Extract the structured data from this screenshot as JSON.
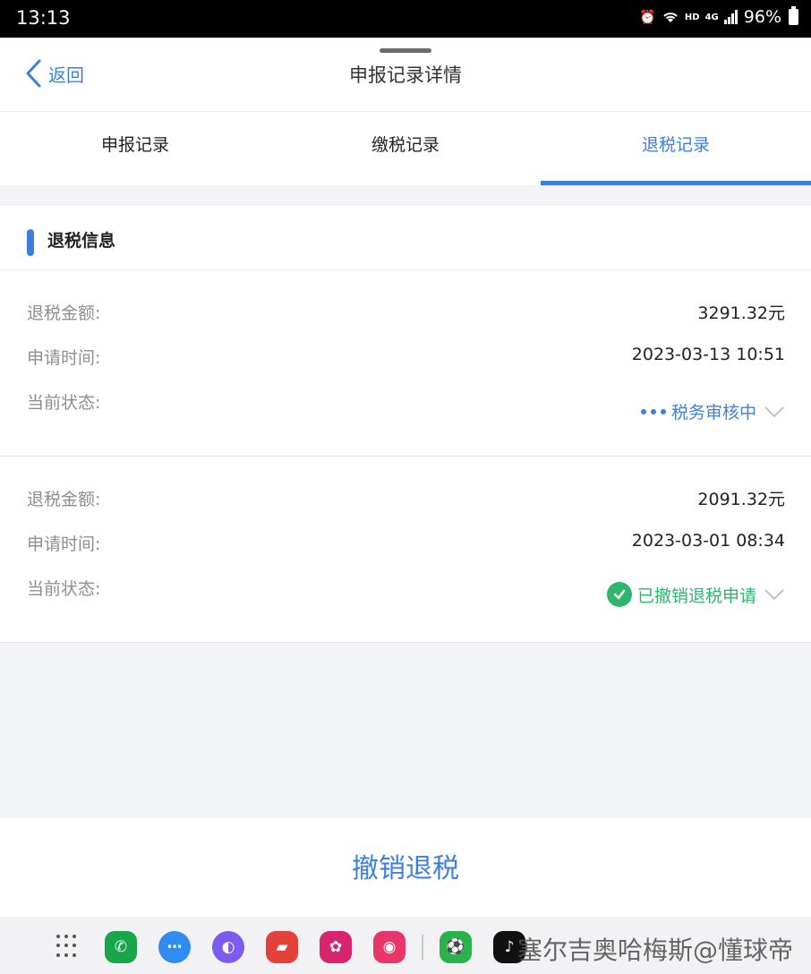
{
  "status_bar": {
    "time": "13:13",
    "hd": "HD",
    "network": "4G",
    "battery": "96%"
  },
  "header": {
    "back_label": "返回",
    "title": "申报记录详情"
  },
  "tabs": [
    {
      "label": "申报记录",
      "active": false
    },
    {
      "label": "缴税记录",
      "active": false
    },
    {
      "label": "退税记录",
      "active": true
    }
  ],
  "section": {
    "title": "退税信息"
  },
  "records": [
    {
      "amount_label": "退税金额:",
      "amount": "3291.32元",
      "time_label": "申请时间:",
      "time": "2023-03-13 10:51",
      "status_label": "当前状态:",
      "status": "税务审核中"
    },
    {
      "amount_label": "退税金额:",
      "amount": "2091.32元",
      "time_label": "申请时间:",
      "time": "2023-03-01 08:34",
      "status_label": "当前状态:",
      "status": "已撤销退税申请"
    }
  ],
  "action": {
    "label": "撤销退税"
  },
  "taskbar": {
    "apps": [
      "apps-grid-icon",
      "phone-icon",
      "messages-icon",
      "browser-icon",
      "notes-icon",
      "gallery-icon",
      "camera-icon",
      "sports-app-icon",
      "tiktok-icon"
    ],
    "watermark": "塞尔吉奥哈梅斯@懂球帝"
  },
  "colors": {
    "accent": "#3d7fe0",
    "success": "#2db66e",
    "label": "#8e8e93"
  }
}
